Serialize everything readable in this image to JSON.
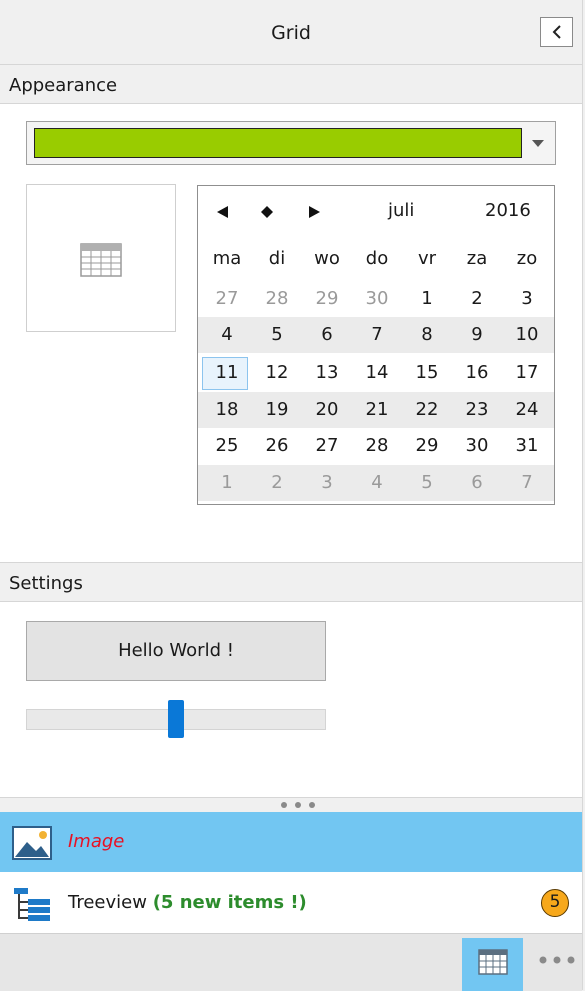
{
  "header": {
    "title": "Grid",
    "collapse_icon": "chevron-left-icon"
  },
  "appearance": {
    "label": "Appearance",
    "color_value": "#99cc00",
    "calendar_icon": "calendar-grid-icon",
    "calendar": {
      "month": "juli",
      "year": "2016",
      "nav_icons": [
        "previous-month-icon",
        "current-month-icon",
        "next-month-icon"
      ],
      "days_of_week": [
        "ma",
        "di",
        "wo",
        "do",
        "vr",
        "za",
        "zo"
      ],
      "weeks": [
        [
          "27",
          "28",
          "29",
          "30",
          "1",
          "2",
          "3"
        ],
        [
          "4",
          "5",
          "6",
          "7",
          "8",
          "9",
          "10"
        ],
        [
          "11",
          "12",
          "13",
          "14",
          "15",
          "16",
          "17"
        ],
        [
          "18",
          "19",
          "20",
          "21",
          "22",
          "23",
          "24"
        ],
        [
          "25",
          "26",
          "27",
          "28",
          "29",
          "30",
          "31"
        ],
        [
          "1",
          "2",
          "3",
          "4",
          "5",
          "6",
          "7"
        ]
      ],
      "selected_day": "11"
    }
  },
  "settings": {
    "label": "Settings",
    "button_label": "Hello World !",
    "slider_value": 0.5
  },
  "nav": {
    "items": [
      {
        "label": "Image",
        "icon": "image-icon",
        "selected": true
      },
      {
        "label_prefix": "Treeview",
        "label_highlight": "(5 new items !)",
        "icon": "treeview-icon",
        "badge": "5"
      }
    ]
  },
  "bottombar": {
    "icons": [
      "grid-icon",
      "more-icon"
    ]
  },
  "colors": {
    "accent": "#72c6f2",
    "slider": "#0a78d7",
    "badge": "#f7a81b",
    "highlight_green": "#2d8c2d",
    "highlight_red": "#e81123"
  }
}
